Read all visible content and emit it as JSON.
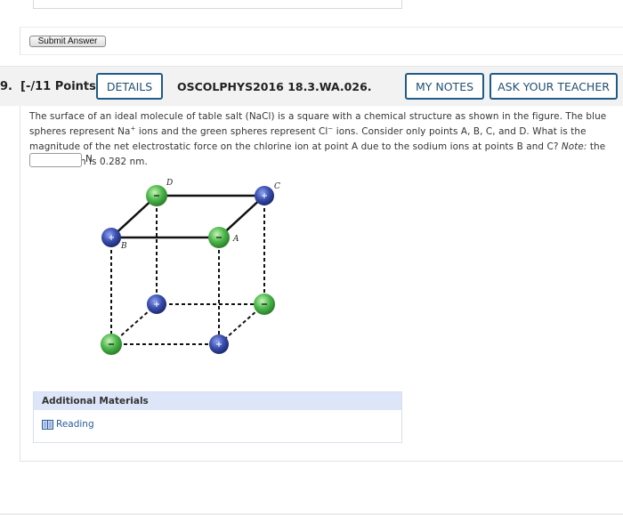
{
  "submit": {
    "label": "Submit Answer"
  },
  "header": {
    "number": "9.",
    "points": "[-/11 Points]",
    "details": "DETAILS",
    "code": "OSCOLPHYS2016 18.3.WA.026.",
    "my_notes": "MY NOTES",
    "ask_teacher": "ASK YOUR TEACHER"
  },
  "question": {
    "p1": "The surface of an ideal molecule of table salt (NaCl) is a square with a chemical structure as shown in the figure. The blue spheres represent Na",
    "sup1": "+",
    "p2": " ions and the green spheres represent Cl",
    "sup2": "−",
    "p3": " ions. Consider only points A, B, C, and D. What is the magnitude of the net electrostatic force on the chlorine ion at point A due to the sodium ions at points B and C? ",
    "note_label": "Note:",
    "p4": " the bond length is 0.282 nm.",
    "answer_value": "",
    "unit": "N"
  },
  "figure": {
    "labels": {
      "A": "A",
      "B": "B",
      "C": "C",
      "D": "D"
    },
    "colors": {
      "sodium": "#3a4fb0",
      "chlorine": "#4cb84c"
    }
  },
  "additional": {
    "title": "Additional Materials",
    "reading": "Reading"
  }
}
